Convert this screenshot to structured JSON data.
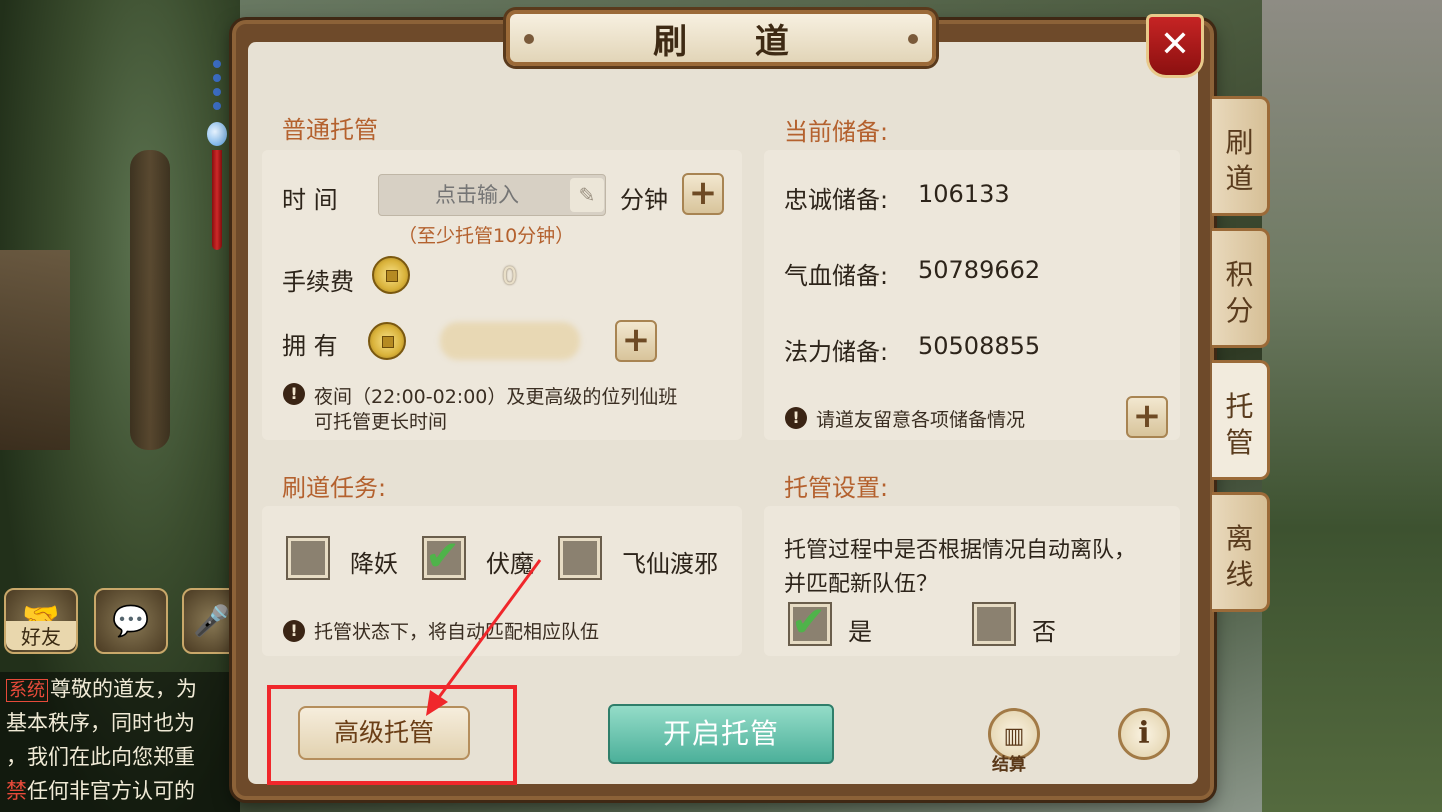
{
  "dialog": {
    "title": "刷 道"
  },
  "normal": {
    "section_title": "普通托管",
    "time_label": "时  间",
    "time_placeholder": "点击输入",
    "minutes_label": "分钟",
    "min_hint": "（至少托管10分钟）",
    "fee_label": "手续费",
    "fee_value": "0",
    "own_label": "拥  有",
    "night_note_line1": "夜间（22:00-02:00）及更高级的位列仙班",
    "night_note_line2": "可托管更长时间"
  },
  "reserve": {
    "section_title": "当前储备:",
    "loyalty_label": "忠诚储备:",
    "loyalty_value": "106133",
    "hp_label": "气血储备:",
    "hp_value": "50789662",
    "mana_label": "法力储备:",
    "mana_value": "50508855",
    "note": "请道友留意各项储备情况"
  },
  "tasks": {
    "section_title": "刷道任务:",
    "items": [
      {
        "label": "降妖",
        "checked": false
      },
      {
        "label": "伏魔",
        "checked": true
      },
      {
        "label": "飞仙渡邪",
        "checked": false
      }
    ],
    "note": "托管状态下，将自动匹配相应队伍"
  },
  "settings": {
    "section_title": "托管设置:",
    "question_line1": "托管过程中是否根据情况自动离队，",
    "question_line2": "并匹配新队伍？",
    "yes_label": "是",
    "yes_checked": true,
    "no_label": "否",
    "no_checked": false
  },
  "footer": {
    "advanced_label": "高级托管",
    "start_label": "开启托管",
    "settle_label": "结算"
  },
  "side_tabs": [
    {
      "label_top": "刷",
      "label_bottom": "道",
      "active": false
    },
    {
      "label_top": "积",
      "label_bottom": "分",
      "active": false
    },
    {
      "label_top": "托",
      "label_bottom": "管",
      "active": true
    },
    {
      "label_top": "离",
      "label_bottom": "线",
      "active": false
    }
  ],
  "social": {
    "friends_label": "好友"
  },
  "chat": {
    "tag": "系统",
    "lines": [
      "尊敬的道友，为",
      "基本秩序，同时也为",
      "，我们在此向您郑重",
      "任何非官方认可的"
    ],
    "ban_char": "禁"
  },
  "colors": {
    "accent": "#b4612e",
    "start_button": "#5cbca6",
    "highlight_frame": "#f0272b",
    "check": "#4fb34a"
  },
  "icons": [
    "pencil-icon",
    "plus-icon",
    "coin-icon",
    "warning-icon",
    "check-icon",
    "close-icon",
    "stats-icon",
    "info-icon",
    "handshake-icon",
    "chat-bubble-icon",
    "microphone-icon"
  ]
}
